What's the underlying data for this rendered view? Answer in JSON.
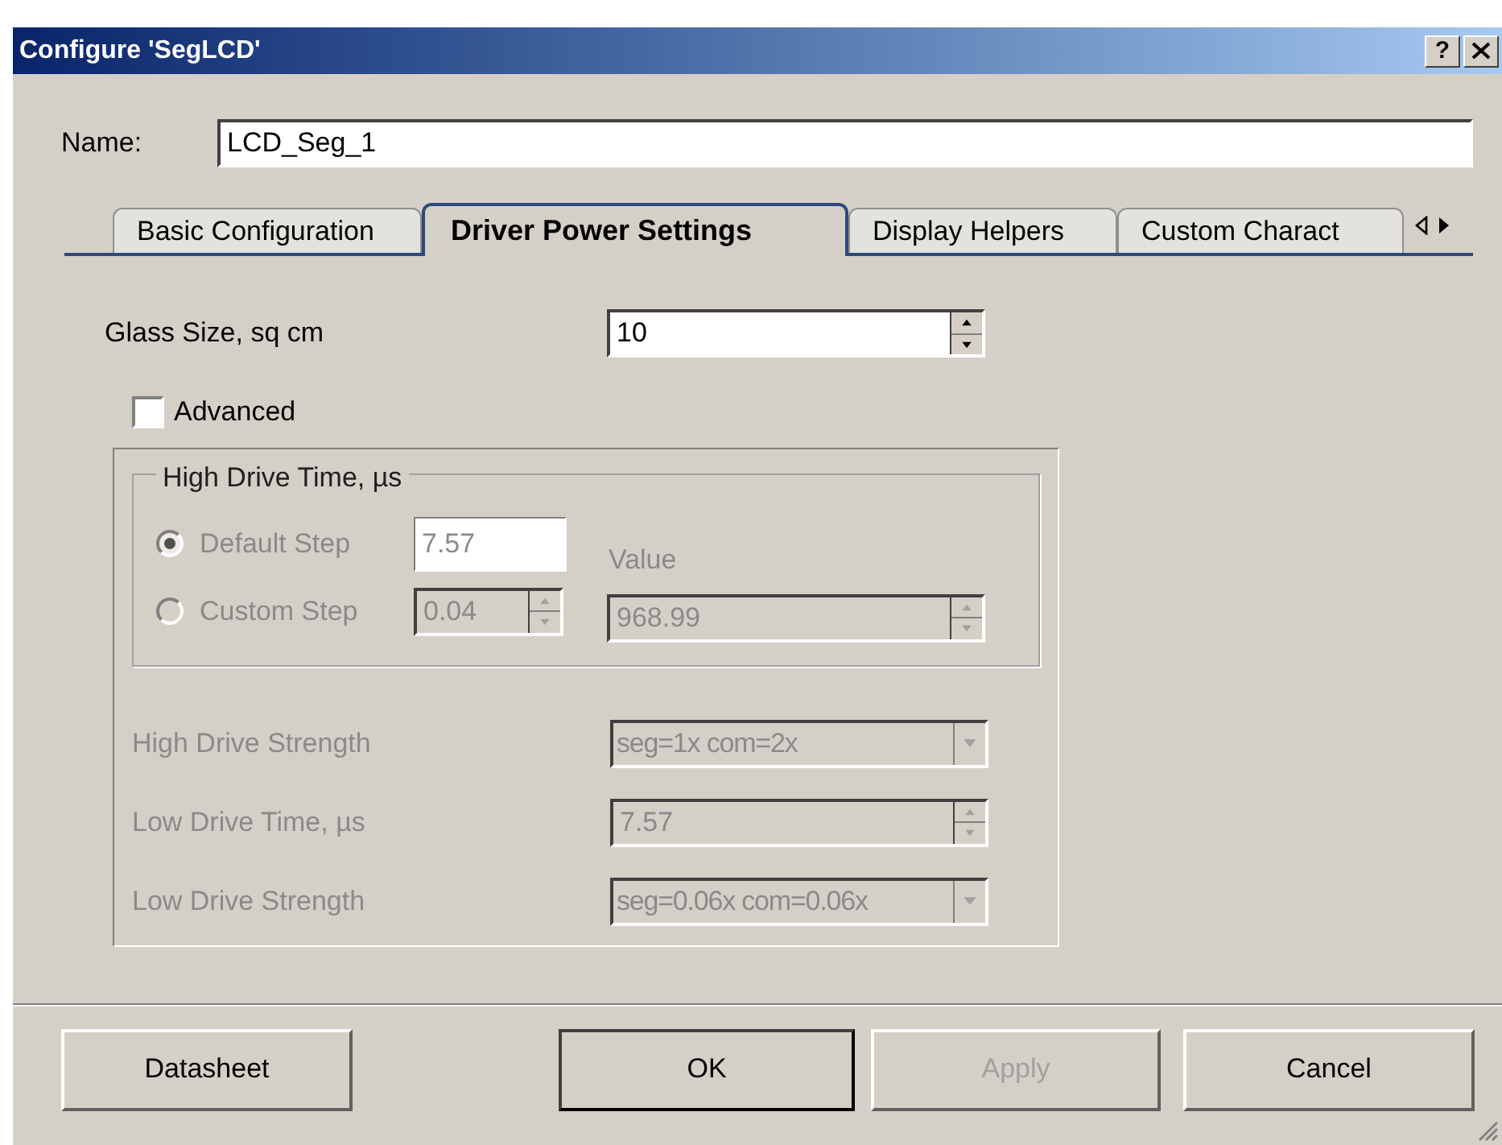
{
  "window": {
    "title": "Configure 'SegLCD'",
    "help_button": "?"
  },
  "name_field": {
    "label": "Name:",
    "value": "LCD_Seg_1"
  },
  "tabs": [
    {
      "label": "Basic Configuration",
      "selected": false
    },
    {
      "label": "Driver Power Settings",
      "selected": true
    },
    {
      "label": "Display Helpers",
      "selected": false
    },
    {
      "label": "Custom Charact",
      "selected": false
    }
  ],
  "glass_size": {
    "label": "Glass Size, sq cm",
    "value": "10"
  },
  "advanced": {
    "label": "Advanced",
    "checked": false,
    "disabled": true,
    "high_drive_time": {
      "title": "High Drive Time, µs",
      "value_label": "Value",
      "value": "968.99",
      "options": [
        {
          "label": "Default Step",
          "selected": true,
          "kind": "text",
          "value": "7.57"
        },
        {
          "label": "Custom Step",
          "selected": false,
          "kind": "spinner",
          "value": "0.04"
        }
      ]
    },
    "rows": [
      {
        "label": "High Drive Strength",
        "kind": "dropdown",
        "value": "seg=1x com=2x"
      },
      {
        "label": "Low Drive Time, µs",
        "kind": "spinner",
        "value": "7.57"
      },
      {
        "label": "Low Drive Strength",
        "kind": "dropdown",
        "value": "seg=0.06x com=0.06x"
      }
    ]
  },
  "buttons": [
    {
      "label": "Datasheet",
      "disabled": false,
      "default": false
    },
    {
      "label": "OK",
      "disabled": false,
      "default": true
    },
    {
      "label": "Apply",
      "disabled": true,
      "default": false
    },
    {
      "label": "Cancel",
      "disabled": false,
      "default": false
    }
  ]
}
